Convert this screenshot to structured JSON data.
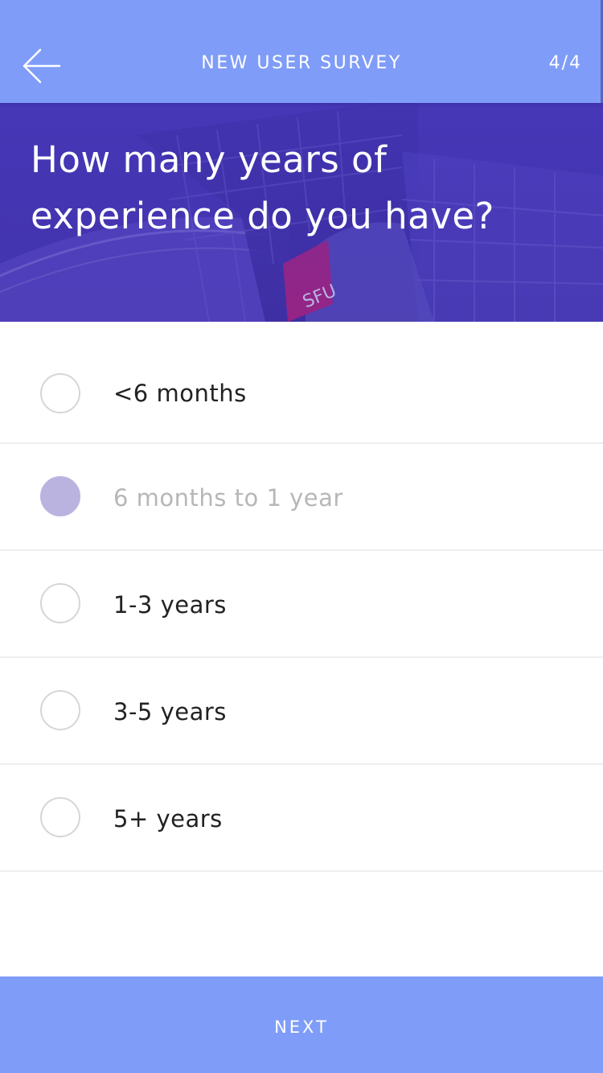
{
  "header": {
    "title": "NEW USER SURVEY",
    "step": "4/4",
    "back_icon": "arrow-left-icon"
  },
  "question": {
    "text": "How many years of experience do you have?"
  },
  "options": [
    {
      "label": "<6 months",
      "selected": false
    },
    {
      "label": "6 months to 1 year",
      "selected": true
    },
    {
      "label": "1-3 years",
      "selected": false
    },
    {
      "label": "3-5 years",
      "selected": false
    },
    {
      "label": "5+ years",
      "selected": false
    }
  ],
  "footer": {
    "next_label": "NEXT"
  },
  "colors": {
    "primary": "#7f9cf8",
    "selected_radio": "#bab3e0",
    "hero_tint": "#4a3fb8"
  }
}
